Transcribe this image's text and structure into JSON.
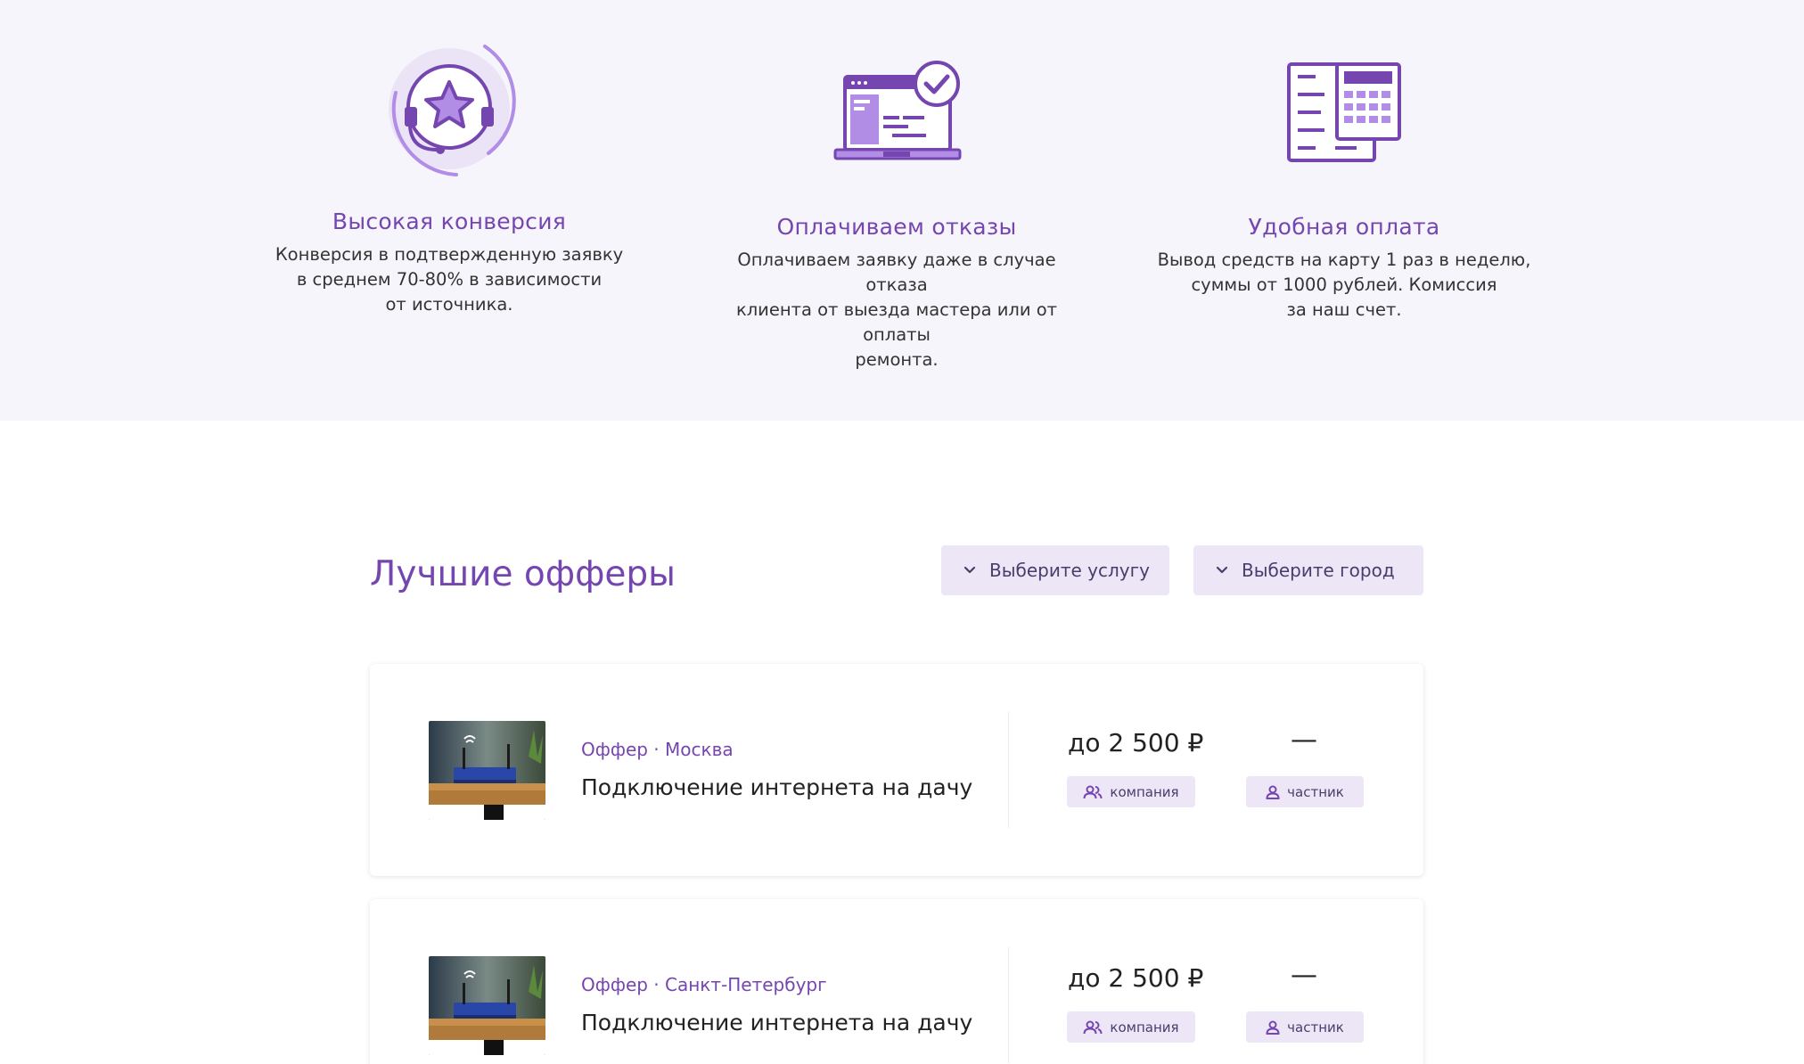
{
  "features": [
    {
      "icon": "headset-star-icon",
      "title": "Высокая конверсия",
      "lines": [
        "Конверсия в подтвержденную заявку",
        "в среднем 70-80% в зависимости",
        "от источника."
      ]
    },
    {
      "icon": "laptop-check-icon",
      "title": "Оплачиваем отказы",
      "lines": [
        "Оплачиваем заявку даже в случае отказа",
        "клиента от выезда мастера или от оплаты",
        "ремонта."
      ]
    },
    {
      "icon": "calculator-document-icon",
      "title": "Удобная оплата",
      "lines": [
        "Вывод средств на карту 1 раз в неделю,",
        "суммы от 1000 рублей. Комиссия",
        "за наш счет."
      ]
    }
  ],
  "offers_section": {
    "title": "Лучшие офферы",
    "service_select": "Выберите услугу",
    "city_select": "Выберите город"
  },
  "offers": [
    {
      "meta": "Оффер · Москва",
      "name": "Подключение интернета на дачу",
      "price": "до 2 500 ₽",
      "private_price": "—",
      "company_label": "компания",
      "private_label": "частник"
    },
    {
      "meta": "Оффер · Санкт-Петербург",
      "name": "Подключение интернета на дачу",
      "price": "до 2 500 ₽",
      "private_price": "—",
      "company_label": "компания",
      "private_label": "частник"
    }
  ],
  "colors": {
    "accent": "#7546b0",
    "light_purple": "#b18de6",
    "chip_bg": "#ece6f7",
    "section_bg": "#f7f5fc"
  }
}
